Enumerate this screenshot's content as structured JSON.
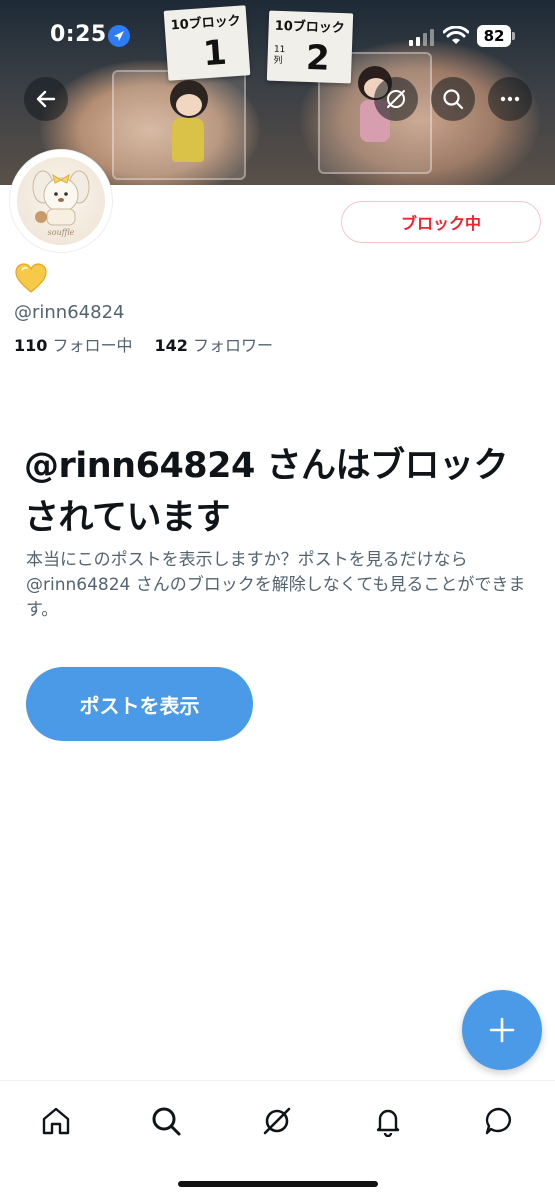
{
  "status_bar": {
    "time": "0:25",
    "battery": "82"
  },
  "banner": {
    "card1": {
      "top": "10ブロック",
      "number": "1"
    },
    "card2": {
      "top": "10ブロック",
      "number": "2",
      "side_line1": "11",
      "side_line2": "列"
    }
  },
  "header_buttons": {
    "back_icon": "arrow-left-icon",
    "grok_icon": "slash-circle-icon",
    "search_icon": "search-icon",
    "more_icon": "more-dots-icon"
  },
  "profile": {
    "emoji": "yellow-heart",
    "handle": "@rinn64824",
    "following_count": "110",
    "following_label": "フォロー中",
    "followers_count": "142",
    "followers_label": "フォロワー",
    "blocking_button": "ブロック中"
  },
  "blocked_notice": {
    "title": "@rinn64824 さんはブロックされています",
    "description": "本当にこのポストを表示しますか？ポストを見るだけなら @rinn64824 さんのブロックを解除しなくても見ることができます。",
    "view_posts_button": "ポストを表示"
  },
  "colors": {
    "accent": "#4a9ae8",
    "danger": "#f4212e",
    "secondary_text": "#536471"
  },
  "tab_bar": [
    "home-icon",
    "search-icon",
    "grok-icon",
    "notifications-icon",
    "messages-icon"
  ]
}
